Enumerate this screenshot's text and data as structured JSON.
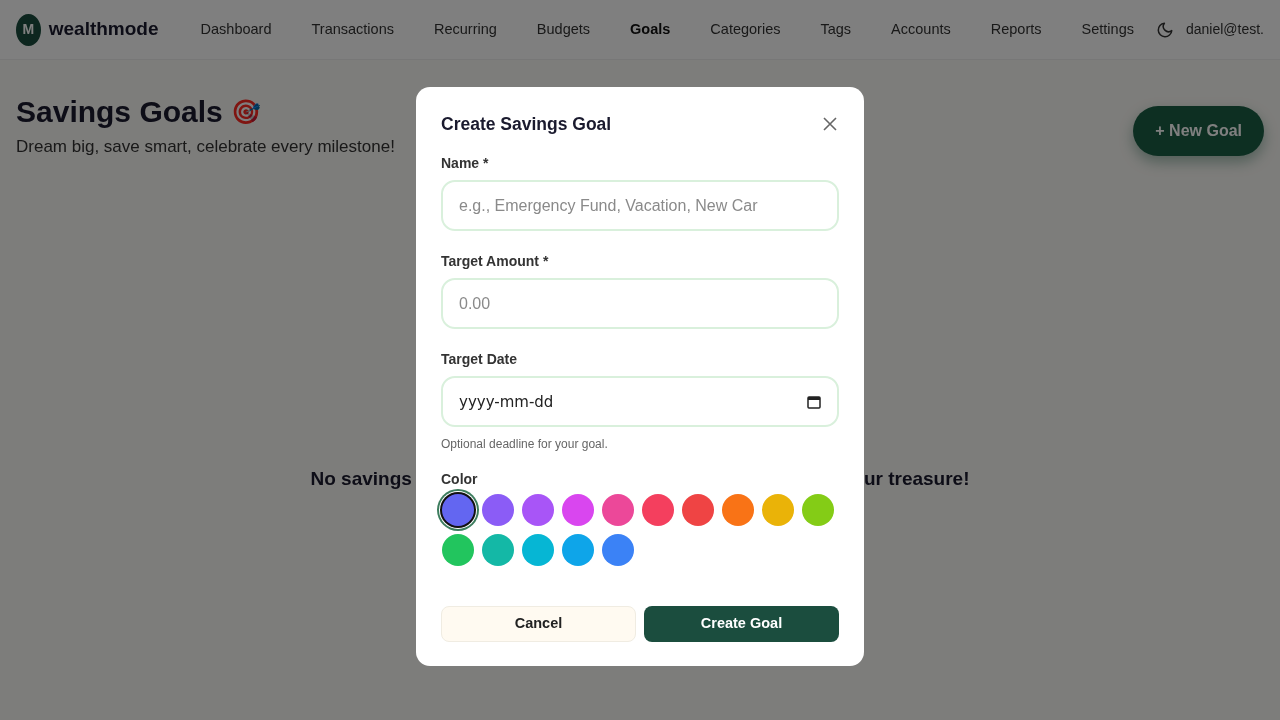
{
  "brand": {
    "initial": "M",
    "name": "wealthmode"
  },
  "nav": [
    {
      "label": "Dashboard",
      "selected": false
    },
    {
      "label": "Transactions",
      "selected": false
    },
    {
      "label": "Recurring",
      "selected": false
    },
    {
      "label": "Budgets",
      "selected": false
    },
    {
      "label": "Goals",
      "selected": true
    },
    {
      "label": "Categories",
      "selected": false
    },
    {
      "label": "Tags",
      "selected": false
    },
    {
      "label": "Accounts",
      "selected": false
    },
    {
      "label": "Reports",
      "selected": false
    },
    {
      "label": "Settings",
      "selected": false
    }
  ],
  "user": "daniel@test.",
  "page": {
    "title": "Savings Goals",
    "emoji": "🎯",
    "subtitle": "Dream big, save smart, celebrate every milestone!",
    "new_button": "+ New Goal",
    "empty_left": "No savings",
    "empty_right": "ur treasure!"
  },
  "modal": {
    "title": "Create Savings Goal",
    "fields": [
      {
        "label": "Name *",
        "placeholder": "e.g., Emergency Fund, Vacation, New Car",
        "kind": "text"
      },
      {
        "label": "Target Amount *",
        "placeholder": "0.00",
        "kind": "text"
      },
      {
        "label": "Target Date",
        "value": "yyyy-mm-dd",
        "kind": "date",
        "help": "Optional deadline for your goal."
      }
    ],
    "color_label": "Color",
    "colors": [
      {
        "color": "#6366f1",
        "selected": true
      },
      {
        "color": "#8b5cf6",
        "selected": false
      },
      {
        "color": "#a855f7",
        "selected": false
      },
      {
        "color": "#d946ef",
        "selected": false
      },
      {
        "color": "#ec4899",
        "selected": false
      },
      {
        "color": "#f43f5e",
        "selected": false
      },
      {
        "color": "#ef4444",
        "selected": false
      },
      {
        "color": "#f97316",
        "selected": false
      },
      {
        "color": "#eab308",
        "selected": false
      },
      {
        "color": "#84cc16",
        "selected": false
      },
      {
        "color": "#22c55e",
        "selected": false
      },
      {
        "color": "#14b8a6",
        "selected": false
      },
      {
        "color": "#06b6d4",
        "selected": false
      },
      {
        "color": "#0ea5e9",
        "selected": false
      },
      {
        "color": "#3b82f6",
        "selected": false
      }
    ],
    "cancel": "Cancel",
    "submit": "Create Goal"
  }
}
